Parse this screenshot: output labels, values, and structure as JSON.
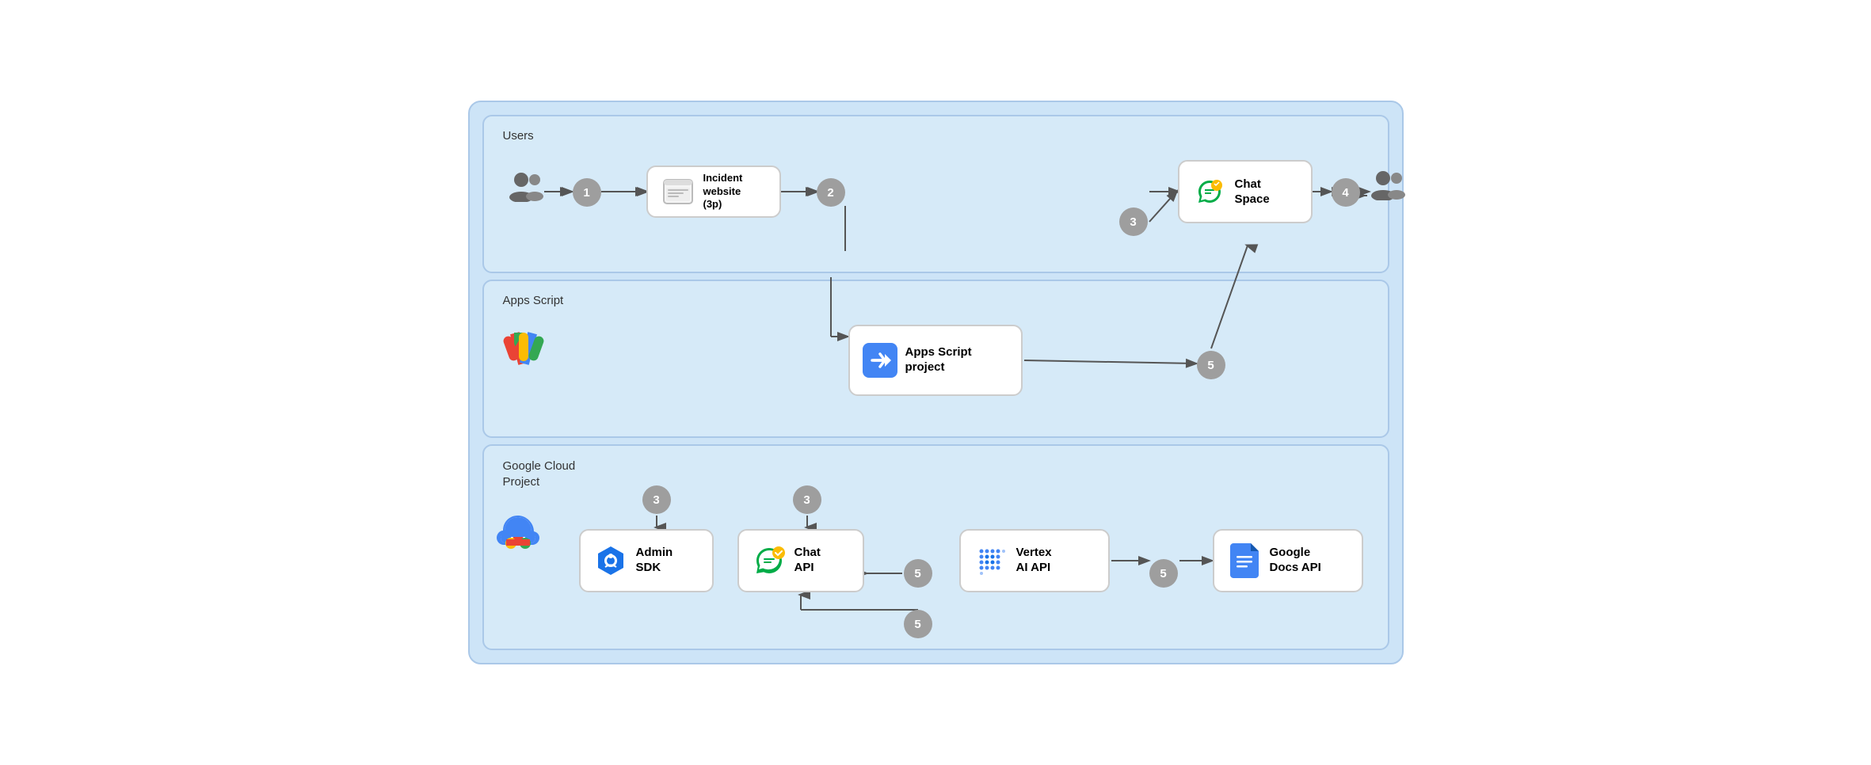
{
  "diagram": {
    "rows": [
      {
        "id": "users-row",
        "label": "Users",
        "nodes": [
          {
            "id": "user-icon-left",
            "type": "icon",
            "icon": "users"
          },
          {
            "id": "step1",
            "type": "step",
            "number": "1"
          },
          {
            "id": "incident-website",
            "type": "box",
            "label": "Incident\nwebsite\n(3p)",
            "icon": "browser"
          },
          {
            "id": "step2",
            "type": "step",
            "number": "2"
          },
          {
            "id": "step3-top",
            "type": "step",
            "number": "3"
          },
          {
            "id": "chat-space",
            "type": "box",
            "label": "Chat\nSpace",
            "icon": "chat"
          },
          {
            "id": "step4",
            "type": "step",
            "number": "4"
          },
          {
            "id": "user-icon-right",
            "type": "icon",
            "icon": "users"
          }
        ]
      },
      {
        "id": "apps-script-row",
        "label": "Apps Script",
        "nodes": [
          {
            "id": "apps-script-logo",
            "type": "logo",
            "icon": "appscript"
          },
          {
            "id": "apps-script-project",
            "type": "box",
            "label": "Apps Script\nproject",
            "icon": "appsscript-project"
          },
          {
            "id": "step5-top",
            "type": "step",
            "number": "5"
          }
        ]
      },
      {
        "id": "gcloud-row",
        "label": "Google Cloud\nProject",
        "nodes": [
          {
            "id": "gcloud-logo",
            "type": "logo",
            "icon": "gcloud"
          },
          {
            "id": "step3-left",
            "type": "step",
            "number": "3"
          },
          {
            "id": "admin-sdk",
            "type": "box",
            "label": "Admin\nSDK",
            "icon": "adminsdk"
          },
          {
            "id": "step3-mid",
            "type": "step",
            "number": "3"
          },
          {
            "id": "chat-api",
            "type": "box",
            "label": "Chat\nAPI",
            "icon": "chat"
          },
          {
            "id": "step5-mid",
            "type": "step",
            "number": "5"
          },
          {
            "id": "vertex-ai",
            "type": "box",
            "label": "Vertex\nAI API",
            "icon": "vertex"
          },
          {
            "id": "step5-right",
            "type": "step",
            "number": "5"
          },
          {
            "id": "google-docs-api",
            "type": "box",
            "label": "Google\nDocs API",
            "icon": "docs"
          },
          {
            "id": "step5-bottom",
            "type": "step",
            "number": "5"
          }
        ]
      }
    ],
    "colors": {
      "background": "#cde4f7",
      "row_bg": "#d6eaf8",
      "row_border": "#aac8e8",
      "node_border": "#ccc",
      "node_bg": "#fff",
      "step_bg": "#9e9e9e",
      "step_text": "#fff",
      "arrow": "#555"
    }
  }
}
